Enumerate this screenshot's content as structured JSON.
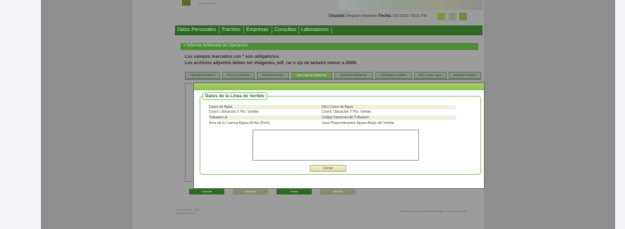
{
  "header": {
    "logo_text": "Aqua Sistema",
    "user_label": "Usuario:",
    "user_value": "Alejandro Alejandro",
    "date_label": "Fecha:",
    "date_value": "16/12/2017 05:21 PM"
  },
  "nav": {
    "items": [
      "Datos Personales",
      "Trámites",
      "Empresas",
      "Consultas",
      "Laboratorios"
    ]
  },
  "panel": {
    "title": "> Informe Ambiental de Operación",
    "required_note": "Los campos marcados con * son obligatorios",
    "attachments_note": "Los archivos adjuntos deben ser imágenes, pdf, rar o zip de tamaño menor a 20Mb"
  },
  "tabs": [
    {
      "label": "Información Básica",
      "active": false
    },
    {
      "label": "Prod. y Consumo",
      "active": false
    },
    {
      "label": "Efluentes Brutos",
      "active": false
    },
    {
      "label": "Descarga de Efluentes",
      "active": true
    },
    {
      "label": "Monitoreo Efluentes",
      "active": false
    },
    {
      "label": "Resultados Análisis",
      "active": false
    },
    {
      "label": "Mon. Curso Agua",
      "active": false
    },
    {
      "label": "Residuos Sólidos",
      "active": false
    }
  ],
  "background_buttons": [
    "Guardar",
    "Cancelar",
    "Enviar",
    "Imprimir"
  ],
  "footer": {
    "left_line1": "Aqua Sistema - 2017",
    "left_line2": "(c) Aqua Sistema",
    "right": "Sistema de Gestión para Profesionales - Versión 3.0 (build)"
  },
  "modal": {
    "legend": "Datos de la Línea de Vertido",
    "rows": [
      {
        "left": "Curso de Agua",
        "right": "Otro Curso de Agua"
      },
      {
        "left": "Coord. Ubicación X Pto. Vertido",
        "right": "Coord. Ubicación Y Pto. Vertido"
      },
      {
        "left": "Tributario al",
        "right": "Código Nacional del Tributario"
      },
      {
        "left": "Área de la Cuenca Aguas Arriba (Km2)",
        "right": "Usos Preponderantes Aguas Abajo del Vertido"
      }
    ],
    "close_label": "Cerrar"
  },
  "colors": {
    "nav_green": "#2f6a25",
    "modal_header": "#9ccb5e",
    "fieldset_border": "#8ac26a",
    "close_button": "#e8e6bf"
  }
}
